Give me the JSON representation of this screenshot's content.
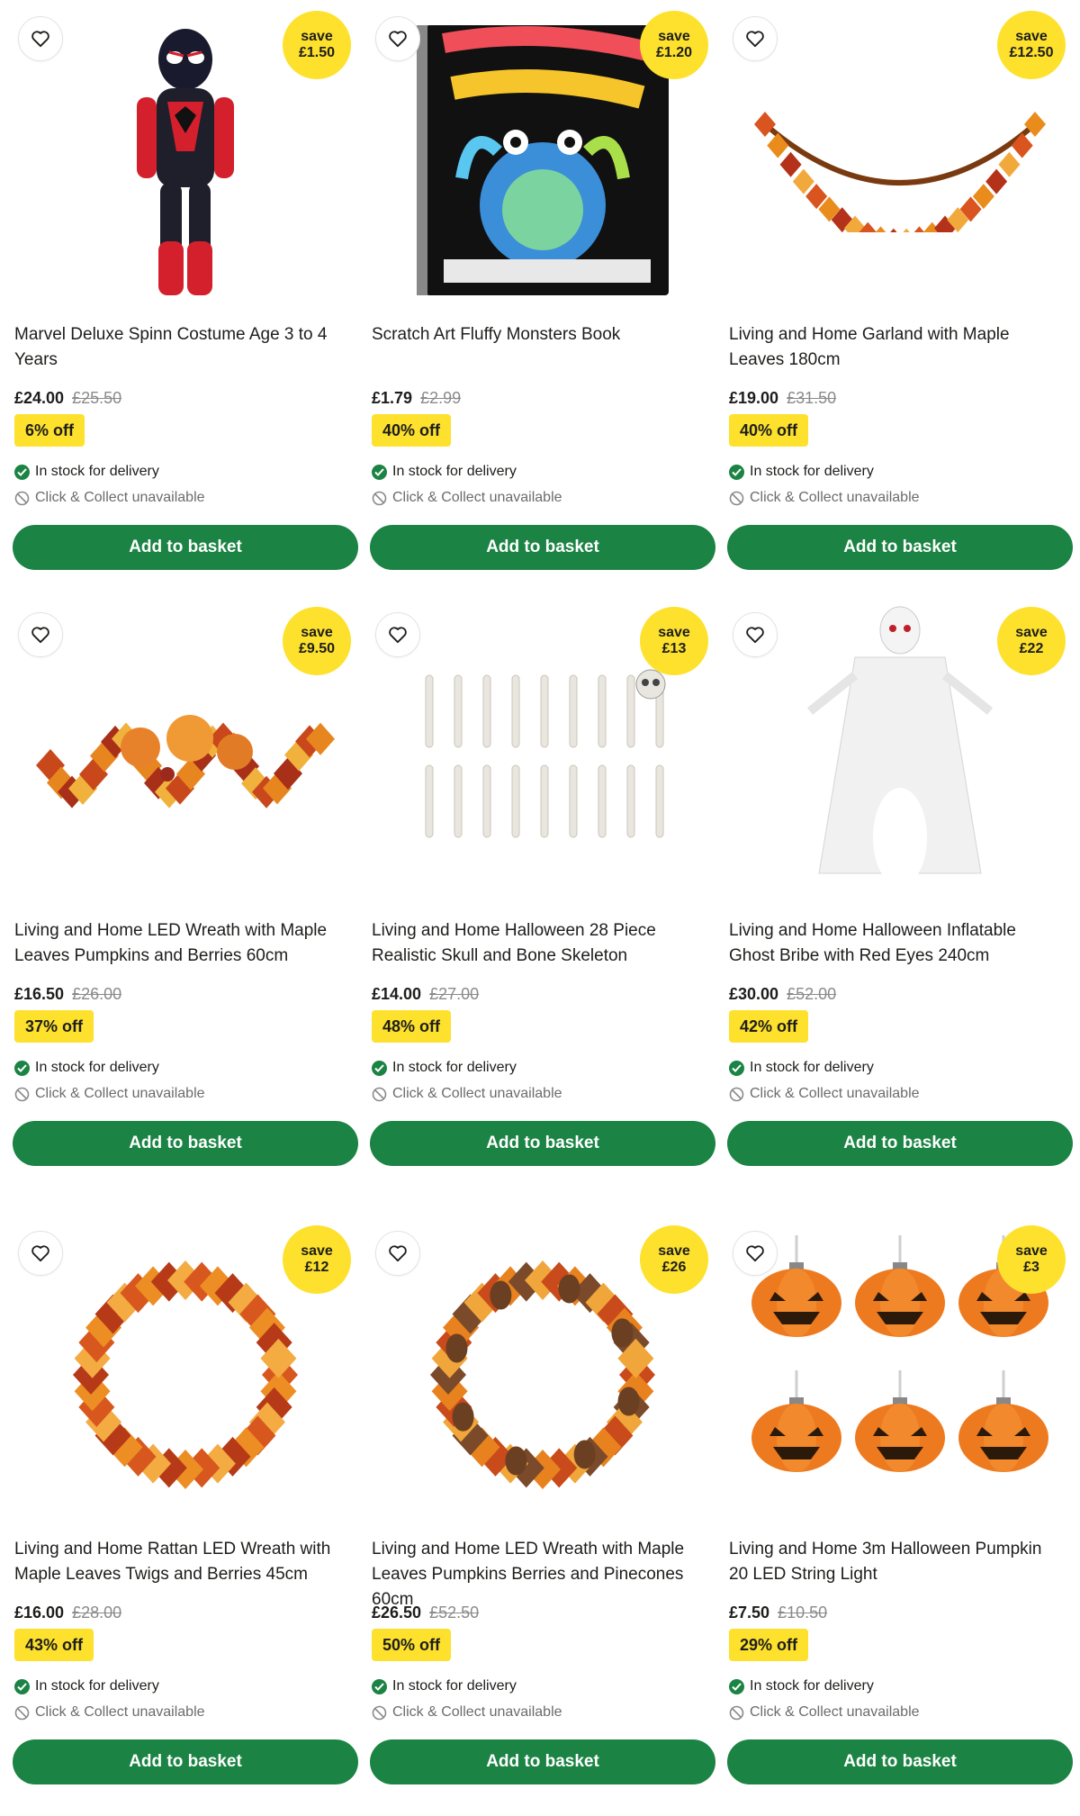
{
  "colors": {
    "accent_green": "#1b8343",
    "badge_yellow": "#fde12d",
    "strike_gray": "#8a8a8a"
  },
  "products": [
    {
      "image_icon": "costume-image",
      "save_label": "save",
      "save_amount": "£1.50",
      "title": "Marvel Deluxe Spinn Costume Age 3 to 4 Years",
      "price": "£24.00",
      "was_price": "£25.50",
      "discount": "6% off",
      "stock": "In stock for delivery",
      "collect": "Click & Collect unavailable",
      "button": "Add to basket"
    },
    {
      "image_icon": "book-image",
      "save_label": "save",
      "save_amount": "£1.20",
      "title": "Scratch Art Fluffy Monsters Book",
      "price": "£1.79",
      "was_price": "£2.99",
      "discount": "40% off",
      "stock": "In stock for delivery",
      "collect": "Click & Collect unavailable",
      "button": "Add to basket"
    },
    {
      "image_icon": "garland-image",
      "save_label": "save",
      "save_amount": "£12.50",
      "title": "Living and Home Garland with Maple Leaves 180cm",
      "price": "£19.00",
      "was_price": "£31.50",
      "discount": "40% off",
      "stock": "In stock for delivery",
      "collect": "Click & Collect unavailable",
      "button": "Add to basket"
    },
    {
      "image_icon": "arrangement-image",
      "save_label": "save",
      "save_amount": "£9.50",
      "title": "Living and Home LED Wreath with Maple Leaves Pumpkins and Berries 60cm",
      "price": "£16.50",
      "was_price": "£26.00",
      "discount": "37% off",
      "stock": "In stock for delivery",
      "collect": "Click & Collect unavailable",
      "button": "Add to basket"
    },
    {
      "image_icon": "skeleton-image",
      "save_label": "save",
      "save_amount": "£13",
      "title": "Living and Home Halloween 28 Piece Realistic Skull and Bone Skeleton",
      "price": "£14.00",
      "was_price": "£27.00",
      "discount": "48% off",
      "stock": "In stock for delivery",
      "collect": "Click & Collect unavailable",
      "button": "Add to basket"
    },
    {
      "image_icon": "ghost-image",
      "save_label": "save",
      "save_amount": "£22",
      "title": "Living and Home Halloween Inflatable Ghost Bribe with Red Eyes 240cm",
      "price": "£30.00",
      "was_price": "£52.00",
      "discount": "42% off",
      "stock": "In stock for delivery",
      "collect": "Click & Collect unavailable",
      "button": "Add to basket"
    },
    {
      "image_icon": "wreath-image",
      "save_label": "save",
      "save_amount": "£12",
      "title": "Living and Home Rattan LED Wreath with Maple Leaves Twigs and Berries 45cm",
      "price": "£16.00",
      "was_price": "£28.00",
      "discount": "43% off",
      "stock": "In stock for delivery",
      "collect": "Click & Collect unavailable",
      "button": "Add to basket"
    },
    {
      "image_icon": "pinecone-wreath-image",
      "save_label": "save",
      "save_amount": "£26",
      "title": "Living and Home LED Wreath with Maple Leaves Pumpkins Berries and Pinecones 60cm",
      "price": "£26.50",
      "was_price": "£52.50",
      "discount": "50% off",
      "stock": "In stock for delivery",
      "collect": "Click & Collect unavailable",
      "button": "Add to basket"
    },
    {
      "image_icon": "pumpkin-lights-image",
      "save_label": "save",
      "save_amount": "£3",
      "title": "Living and Home 3m Halloween Pumpkin 20 LED String Light",
      "price": "£7.50",
      "was_price": "£10.50",
      "discount": "29% off",
      "stock": "In stock for delivery",
      "collect": "Click & Collect unavailable",
      "button": "Add to basket"
    }
  ]
}
